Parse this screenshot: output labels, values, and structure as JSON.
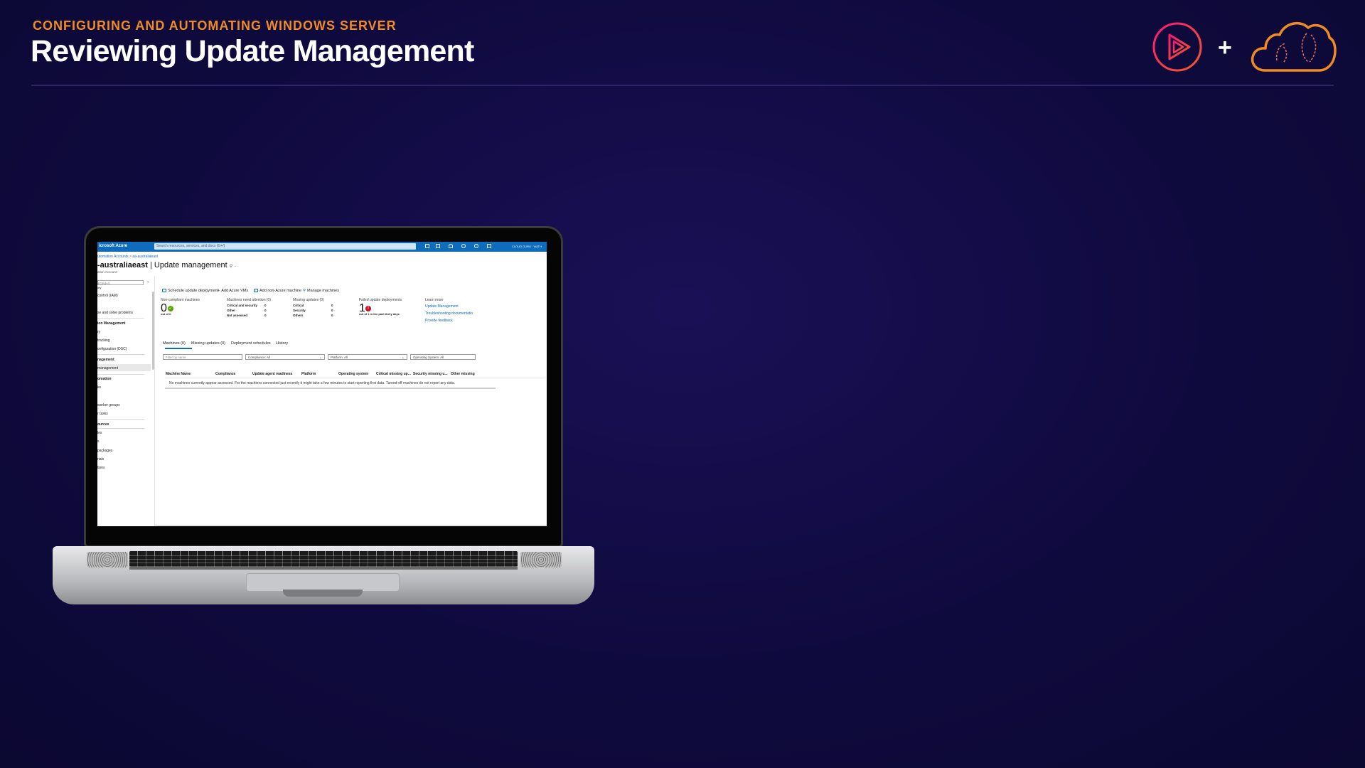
{
  "slide": {
    "eyebrow": "CONFIGURING AND AUTOMATING WINDOWS SERVER",
    "title": "Reviewing Update Management",
    "plus": "+"
  },
  "colors": {
    "accent": "#f08a24",
    "background": "#120c48",
    "azure_blue": "#0f6cbd"
  },
  "azure": {
    "brand": "icrosoft Azure",
    "search_placeholder": "Search resources, services, and docs (G+/)",
    "user": "CLOUD GURU · WATH",
    "breadcrumb": "utomation Accounts  >  aa-australiaeast",
    "page_title_bold": "-australiaeast",
    "page_title_rest": " | Update management",
    "page_subtitle": "ation Account",
    "sidebar": {
      "search": "(Cmd+/)",
      "items": [
        "ory",
        "control (IAM)",
        "se and solve problems",
        "ion Management",
        "ry",
        "tracking",
        "onfiguration (DSC)",
        "nagement",
        "management",
        "omation",
        "ks",
        "worker groups",
        "r tasks",
        "ources",
        "les",
        "s",
        "packages",
        "rials",
        "tions"
      ]
    },
    "toolbar": [
      "Schedule update deployment",
      "Add Azure VMs",
      "Add non-Azure machine",
      "Manage machines"
    ],
    "summary": {
      "noncompliant": {
        "label": "Non-compliant machines",
        "value": "0",
        "sub": "out of 0"
      },
      "attention": {
        "label": "Machines need attention (0)",
        "rows": [
          [
            "Critical and security",
            "0"
          ],
          [
            "Other",
            "0"
          ],
          [
            "Not assessed",
            "0"
          ]
        ]
      },
      "missing": {
        "label": "Missing updates (0)",
        "rows": [
          [
            "Critical",
            "0"
          ],
          [
            "Security",
            "0"
          ],
          [
            "Others",
            "0"
          ]
        ]
      },
      "failed": {
        "label": "Failed update deployments",
        "value": "1",
        "sub": "out of 1 in the past thirty days"
      },
      "learn": {
        "label": "Learn more",
        "links": [
          "Update Management",
          "Troubleshooting documentatio",
          "Provide feedback"
        ]
      }
    },
    "tabs": [
      "Machines (0)",
      "Missing updates (0)",
      "Deployment schedules",
      "History"
    ],
    "filters": {
      "name_placeholder": "Filter by name",
      "compliance": "Compliance: All",
      "platform": "Platform: All",
      "os": "Operating System: All"
    },
    "columns": [
      "Machine Name",
      "Compliance",
      "Update agent readiness",
      "Platform",
      "Operating system",
      "Critical missing up...",
      "Security missing u...",
      "Other missing"
    ],
    "empty_message": "No machines currently appear assessed. For the machines connected just recently it might take a few minutes to start reporting first data. Turned-off machines do not report any data."
  }
}
